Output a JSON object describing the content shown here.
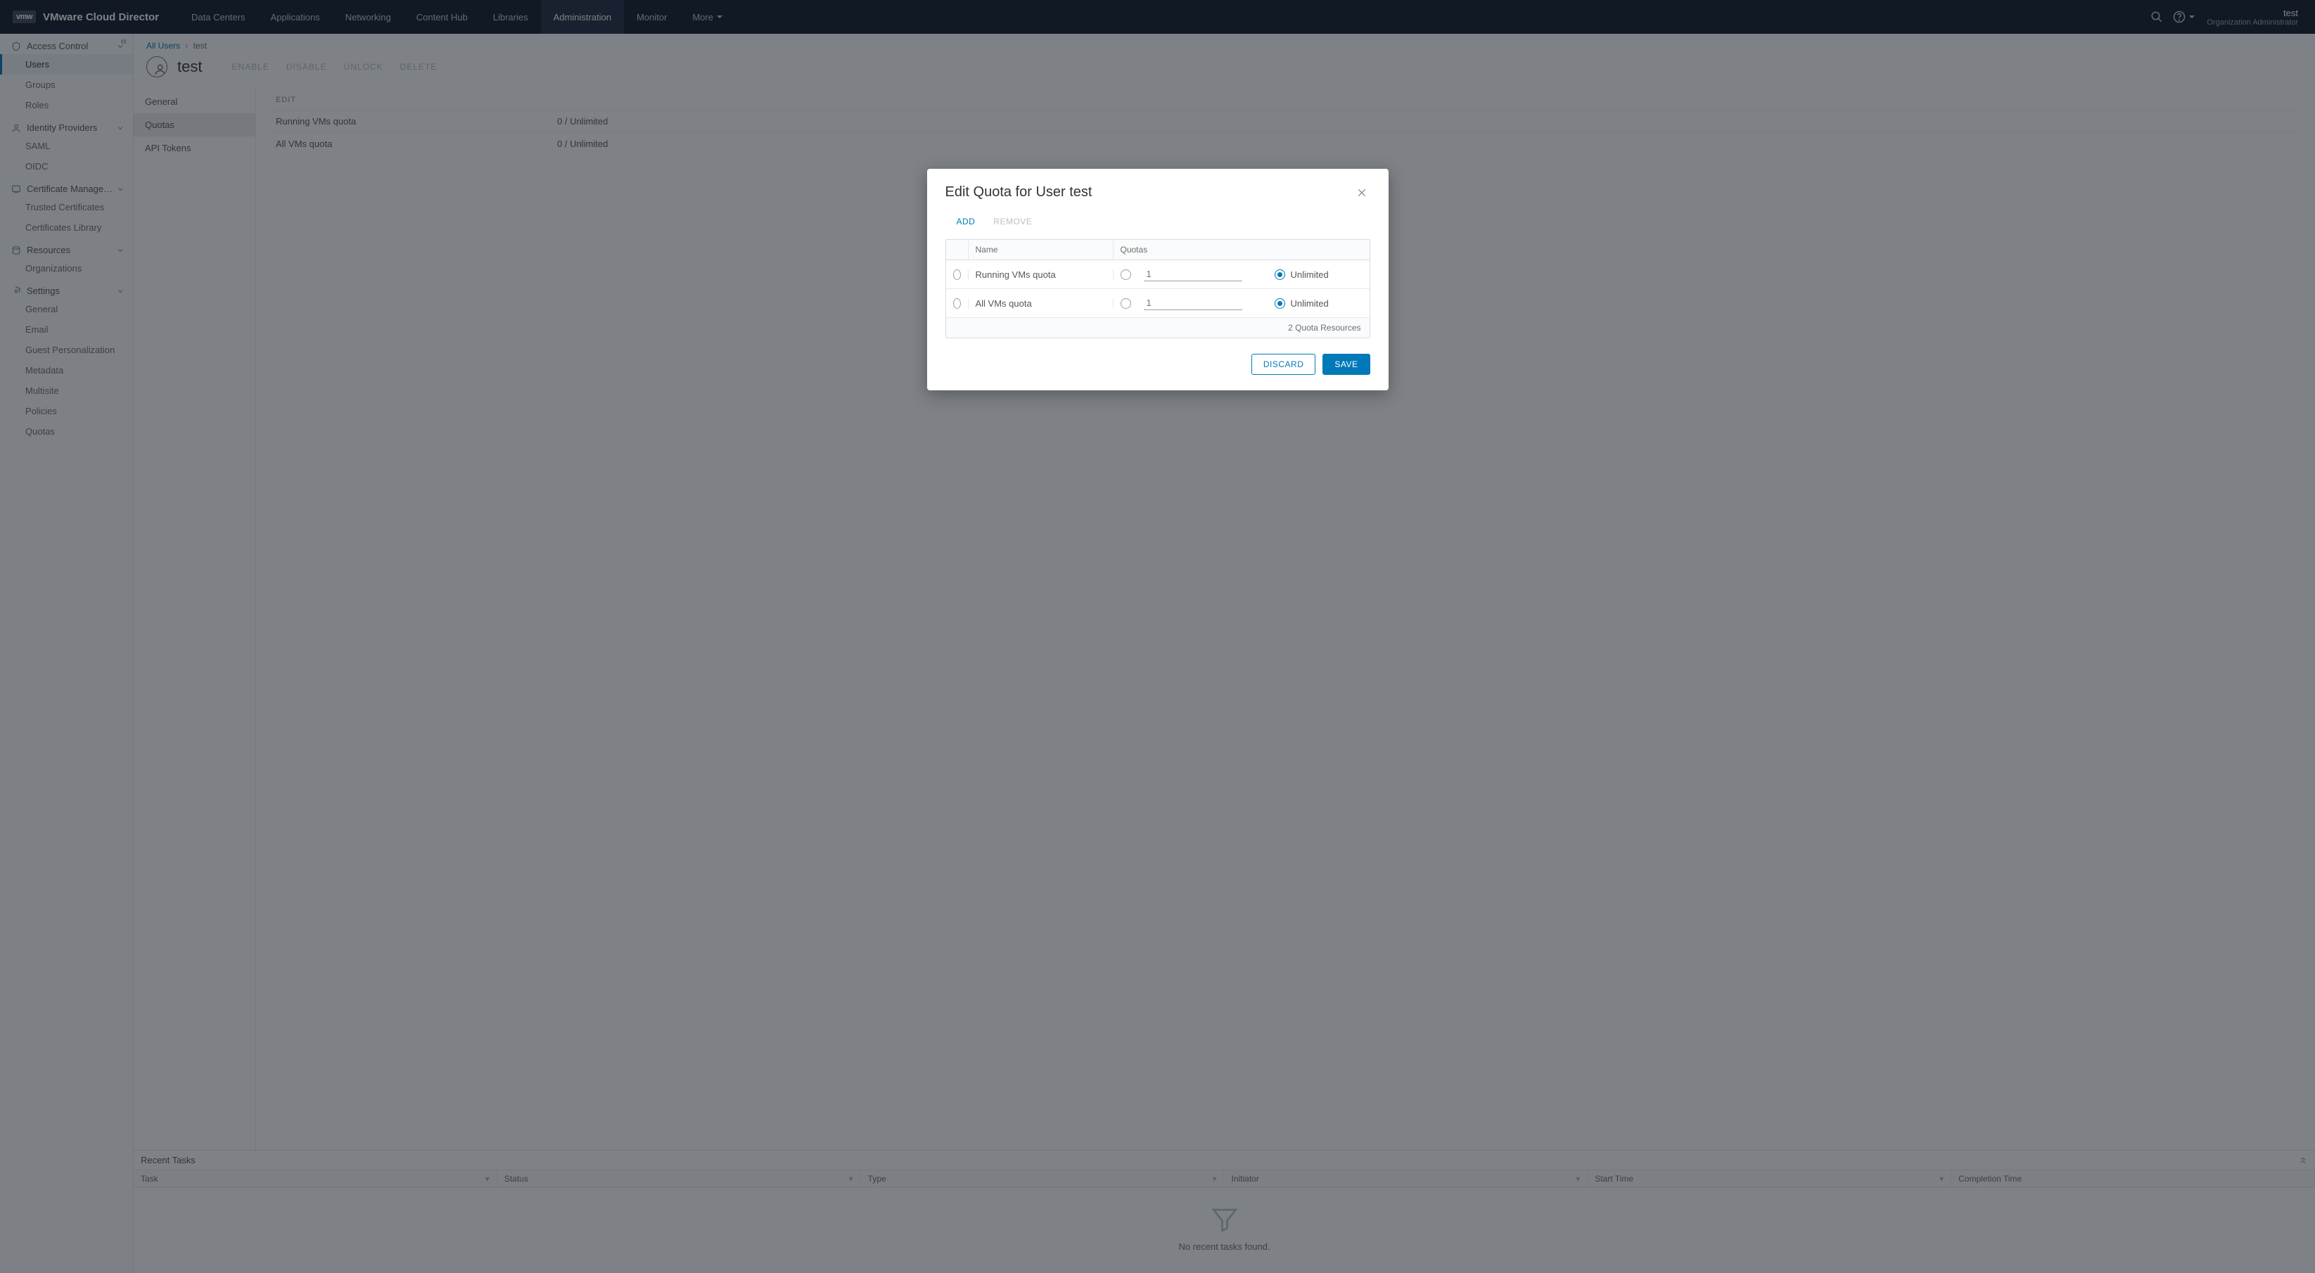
{
  "brand": {
    "badge": "vmw",
    "title": "VMware Cloud Director"
  },
  "nav": {
    "items": [
      "Data Centers",
      "Applications",
      "Networking",
      "Content Hub",
      "Libraries",
      "Administration",
      "Monitor"
    ],
    "more": "More",
    "active_index": 5
  },
  "user": {
    "name": "test",
    "role": "Organization Administrator"
  },
  "sidebar": {
    "groups": [
      {
        "label": "Access Control",
        "icon": "shield",
        "items": [
          "Users",
          "Groups",
          "Roles"
        ],
        "active_item_index": 0
      },
      {
        "label": "Identity Providers",
        "icon": "user",
        "items": [
          "SAML",
          "OIDC"
        ]
      },
      {
        "label": "Certificate Managem…",
        "icon": "cert",
        "items": [
          "Trusted Certificates",
          "Certificates Library"
        ]
      },
      {
        "label": "Resources",
        "icon": "storage",
        "items": [
          "Organizations"
        ]
      },
      {
        "label": "Settings",
        "icon": "gear",
        "items": [
          "General",
          "Email",
          "Guest Personalization",
          "Metadata",
          "Multisite",
          "Policies",
          "Quotas"
        ]
      }
    ]
  },
  "breadcrumb": {
    "root": "All Users",
    "current": "test"
  },
  "page": {
    "title": "test",
    "actions": [
      "ENABLE",
      "DISABLE",
      "UNLOCK",
      "DELETE"
    ]
  },
  "subnav": {
    "items": [
      "General",
      "Quotas",
      "API Tokens"
    ],
    "active_index": 1
  },
  "detail": {
    "header": "EDIT",
    "rows": [
      {
        "k": "Running VMs quota",
        "v": "0 / Unlimited"
      },
      {
        "k": "All VMs quota",
        "v": "0 / Unlimited"
      }
    ]
  },
  "tasks": {
    "title": "Recent Tasks",
    "columns": [
      "Task",
      "Status",
      "Type",
      "Initiator",
      "Start Time",
      "Completion Time"
    ],
    "empty": "No recent tasks found."
  },
  "modal": {
    "title": "Edit Quota for User test",
    "tabs": {
      "add": "ADD",
      "remove": "REMOVE"
    },
    "table": {
      "headers": {
        "name": "Name",
        "quotas": "Quotas"
      },
      "rows": [
        {
          "name": "Running VMs quota",
          "value_placeholder": "1",
          "unlimited_label": "Unlimited",
          "unlimited_selected": true
        },
        {
          "name": "All VMs quota",
          "value_placeholder": "1",
          "unlimited_label": "Unlimited",
          "unlimited_selected": true
        }
      ],
      "footer": "2 Quota Resources"
    },
    "buttons": {
      "discard": "DISCARD",
      "save": "SAVE"
    }
  }
}
